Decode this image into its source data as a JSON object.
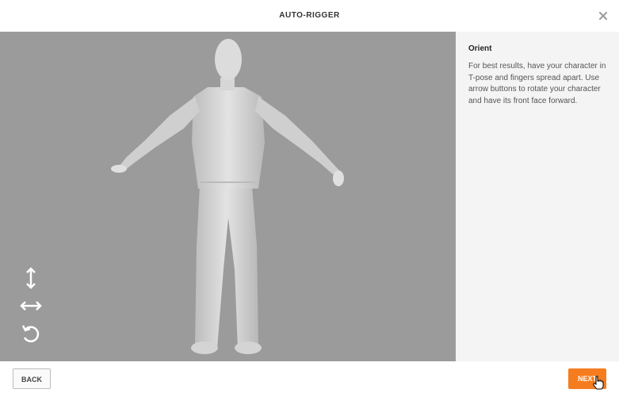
{
  "header": {
    "title": "AUTO-RIGGER",
    "close_icon": "close-icon"
  },
  "viewport": {
    "tools": [
      {
        "icon": "vertical-arrows-icon"
      },
      {
        "icon": "horizontal-arrows-icon"
      },
      {
        "icon": "rotate-icon"
      }
    ]
  },
  "panel": {
    "title": "Orient",
    "description": "For best results, have your character in T-pose and fingers spread apart. Use arrow buttons to rotate your character and have its front face forward."
  },
  "footer": {
    "back_label": "BACK",
    "next_label": "NEXT"
  },
  "colors": {
    "accent": "#f57c1f",
    "viewport_bg": "#9b9b9b",
    "panel_bg": "#f4f4f4"
  }
}
